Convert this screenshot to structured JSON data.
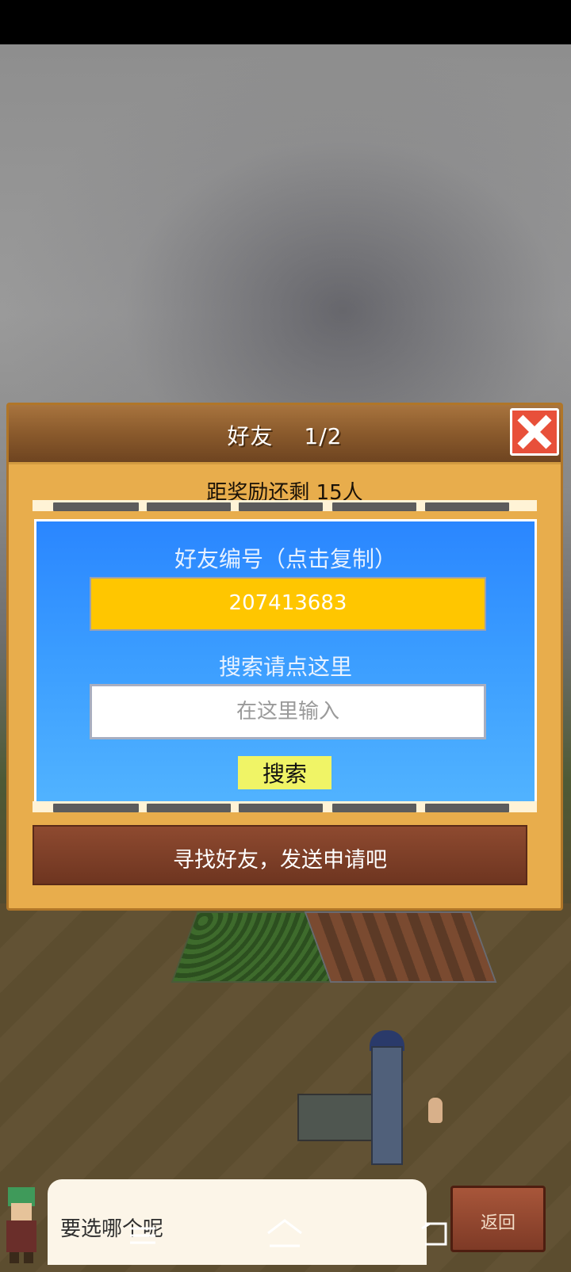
{
  "dialog": {
    "title": "好友　 1/2",
    "reward_text": "距奖励还剩 15人",
    "friend_id_label": "好友编号（点击复制）",
    "friend_id_value": "207413683",
    "search_label": "搜索请点这里",
    "search_placeholder": "在这里输入",
    "search_button": "搜索",
    "find_friends": "寻找好友，发送申请吧"
  },
  "bottom": {
    "speech_text": "要选哪个呢",
    "back_label": "返回"
  },
  "icons": {
    "close": "close-icon",
    "prev_page": "arrow-left-icon",
    "next_page": "arrow-right-icon",
    "menu": "menu-icon",
    "home": "home-icon",
    "back": "back-icon"
  },
  "colors": {
    "dialog_bg": "#e8ad4c",
    "header": "#8a5a2c",
    "panel_blue": "#3a9cff",
    "id_box": "#ffc600",
    "search_button": "#f0f466",
    "close_red": "#e8503a",
    "find_bar": "#7e3f28"
  }
}
